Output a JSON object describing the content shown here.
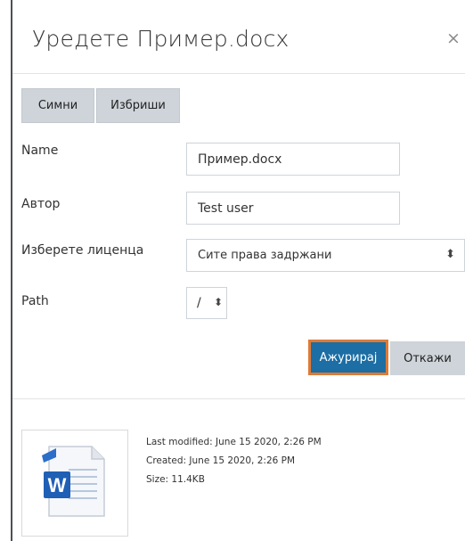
{
  "dialog": {
    "title": "Уредете Пример.docx",
    "close_symbol": "×"
  },
  "actions": {
    "download_label": "Симни",
    "delete_label": "Избриши"
  },
  "form": {
    "name_label": "Name",
    "name_value": "Пример.docx",
    "author_label": "Автор",
    "author_value": "Test user",
    "license_label": "Изберете лиценца",
    "license_value": "Сите права задржани",
    "path_label": "Path",
    "path_value": "/"
  },
  "buttons": {
    "update_label": "Ажурирај",
    "cancel_label": "Откажи"
  },
  "file_info": {
    "icon": "word-document-icon",
    "last_modified": "Last modified: June 15 2020, 2:26 PM",
    "created": "Created: June 15 2020, 2:26 PM",
    "size": "Size: 11.4KB"
  },
  "colors": {
    "primary": "#1c6ea4",
    "highlight": "#e07a35",
    "secondary_button": "#ced4da"
  }
}
